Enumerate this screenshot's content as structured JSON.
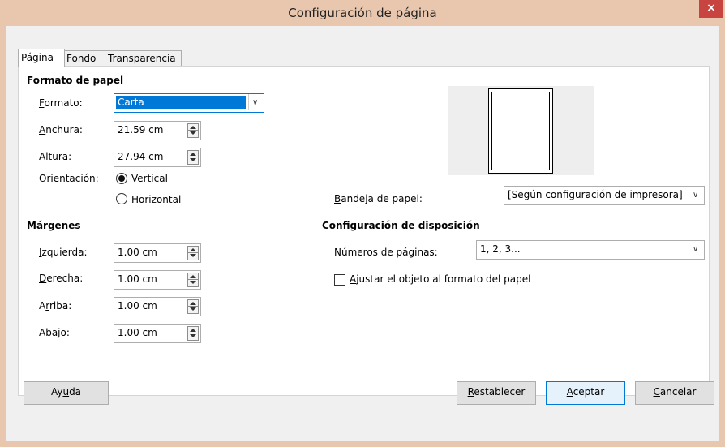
{
  "window": {
    "title": "Configuración de página",
    "close_glyph": "×"
  },
  "tabs": [
    {
      "label": "Página",
      "active": true
    },
    {
      "label": "Fondo",
      "active": false
    },
    {
      "label": "Transparencia",
      "active": false
    }
  ],
  "paper_format": {
    "heading": "Formato de papel",
    "format_label_u": "F",
    "format_label_rest": "ormato:",
    "format_value": "Carta",
    "width_label_u": "A",
    "width_label_rest": "nchura:",
    "width_value": "21.59 cm",
    "height_label_u": "A",
    "height_label_rest": "ltura:",
    "height_value": "27.94 cm",
    "orientation_label_u": "O",
    "orientation_label_rest": "rientación:",
    "vertical_u": "V",
    "vertical_rest": "ertical",
    "horizontal_u": "H",
    "horizontal_rest": "orizontal",
    "orientation_selected": "vertical"
  },
  "paper_tray": {
    "label_u": "B",
    "label_rest": "andeja de papel:",
    "value": "[Según configuración de impresora]"
  },
  "margins": {
    "heading": "Márgenes",
    "left_u": "I",
    "left_rest": "zquierda:",
    "left_value": "1.00 cm",
    "right_u": "D",
    "right_rest": "erecha:",
    "right_value": "1.00 cm",
    "top_pre": "A",
    "top_u": "r",
    "top_rest": "riba:",
    "top_value": "1.00 cm",
    "bottom_label": "Abajo:",
    "bottom_value": "1.00 cm"
  },
  "layout": {
    "heading": "Configuración de disposición",
    "page_numbers_label": "Números de páginas:",
    "page_numbers_value": "1, 2, 3...",
    "fit_u": "A",
    "fit_rest": "justar el objeto al formato del papel",
    "fit_checked": false
  },
  "buttons": {
    "help_pre": "Ay",
    "help_u": "u",
    "help_rest": "da",
    "reset_u": "R",
    "reset_rest": "establecer",
    "ok_u": "A",
    "ok_rest": "ceptar",
    "cancel_u": "C",
    "cancel_rest": "ancelar"
  },
  "colors": {
    "titlebar": "#e8c7ae",
    "close": "#c84440",
    "selection": "#0078d7",
    "preview_bg": "#eeeeee"
  },
  "icons": {
    "close": "close-icon",
    "dropdown": "chevron-down-icon",
    "spinner": "spin-arrows-icon"
  }
}
